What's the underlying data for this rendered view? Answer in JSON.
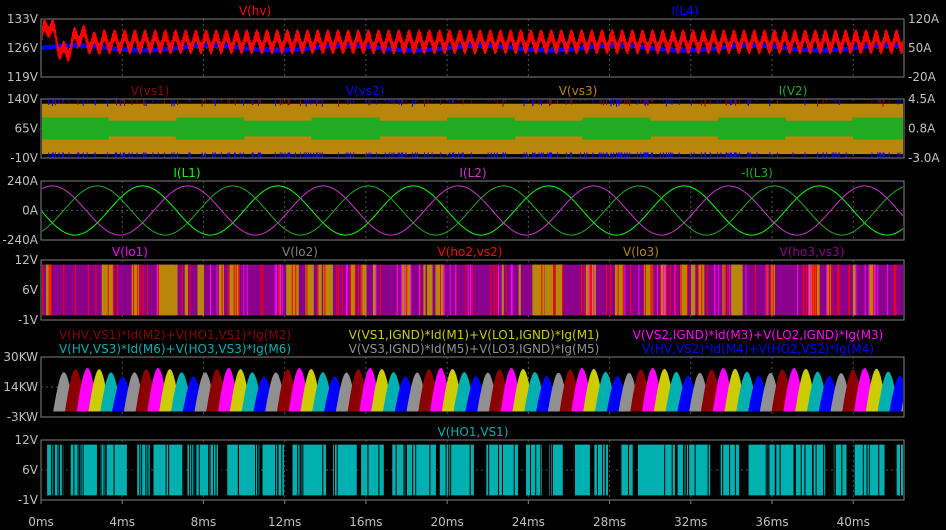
{
  "chart_data": [
    {
      "type": "line",
      "series": [
        {
          "name": "V(hv)",
          "color": "#ff0000"
        },
        {
          "name": "I(L4)",
          "color": "#0000ff"
        }
      ],
      "y_left_ticks": [
        "133V",
        "126V",
        "119V"
      ],
      "y_right_ticks": [
        "120A",
        "50A",
        "-20A"
      ],
      "ylim_left": [
        119,
        133
      ],
      "ylim_right": [
        -20,
        120
      ]
    },
    {
      "type": "line",
      "series": [
        {
          "name": "V(vs1)",
          "color": "#8b0000"
        },
        {
          "name": "V(vs2)",
          "color": "#0000ff"
        },
        {
          "name": "V(vs3)",
          "color": "#b8860b"
        },
        {
          "name": "I(V2)",
          "color": "#22aa22"
        }
      ],
      "y_left_ticks": [
        "140V",
        "65V",
        "-10V"
      ],
      "y_right_ticks": [
        "4.5A",
        "0.8A",
        "-3.0A"
      ],
      "ylim_left": [
        -10,
        140
      ],
      "ylim_right": [
        -3.0,
        4.5
      ]
    },
    {
      "type": "line",
      "series": [
        {
          "name": "I(L1)",
          "color": "#00ff00",
          "amplitude": 200
        },
        {
          "name": "I(L2)",
          "color": "#cc33cc",
          "amplitude": 200
        },
        {
          "name": "-I(L3)",
          "color": "#22aa22",
          "amplitude": 200
        }
      ],
      "y_left_ticks": [
        "240A",
        "0A",
        "-240A"
      ],
      "ylim_left": [
        -240,
        240
      ],
      "frequency_hz": 150
    },
    {
      "type": "line",
      "series": [
        {
          "name": "V(lo1)",
          "color": "#ff00ff"
        },
        {
          "name": "V(lo2)",
          "color": "#808080"
        },
        {
          "name": "V(ho2,vs2)",
          "color": "#ff0000"
        },
        {
          "name": "V(lo3)",
          "color": "#b8860b"
        },
        {
          "name": "V(ho3,vs3)",
          "color": "#8b008b"
        }
      ],
      "y_left_ticks": [
        "12V",
        "6V",
        "-1V"
      ],
      "ylim_left": [
        -1,
        12
      ]
    },
    {
      "type": "area",
      "series": [
        {
          "name": "V(HV,VS1)*Id(M2)+V(HO1,VS1)*Ig(M2)",
          "color": "#8b0000"
        },
        {
          "name": "V(VS1,IGND)*Id(M1)+V(LO1,IGND)*Ig(M1)",
          "color": "#cccc00"
        },
        {
          "name": "V(VS2,IGND)*Id(M3)+V(LO2,IGND)*Ig(M3)",
          "color": "#ff00ff"
        },
        {
          "name": "V(HV,VS3)*Id(M6)+V(HO3,VS3)*Ig(M6)",
          "color": "#00b0b0"
        },
        {
          "name": "V(VS3,IGND)*Id(M5)+V(LO3,IGND)*Ig(M5)",
          "color": "#909090"
        },
        {
          "name": "V(HV,VS2)*Id(M4)+V(HO2,VS2)*Ig(M4)",
          "color": "#0000ff"
        }
      ],
      "y_left_ticks": [
        "30KW",
        "14KW",
        "-3KW"
      ],
      "ylim_left": [
        -3,
        30
      ],
      "peak_kw": 24
    },
    {
      "type": "line",
      "series": [
        {
          "name": "V(HO1,VS1)",
          "color": "#00b0b0"
        }
      ],
      "y_left_ticks": [
        "12V",
        "6V",
        "-1V"
      ],
      "ylim_left": [
        -1,
        12
      ]
    }
  ],
  "x_axis": {
    "ticks": [
      "0ms",
      "4ms",
      "8ms",
      "12ms",
      "16ms",
      "20ms",
      "24ms",
      "28ms",
      "32ms",
      "36ms",
      "40ms"
    ],
    "xlim": [
      0,
      42.5
    ],
    "unit": "ms"
  },
  "grid": true
}
